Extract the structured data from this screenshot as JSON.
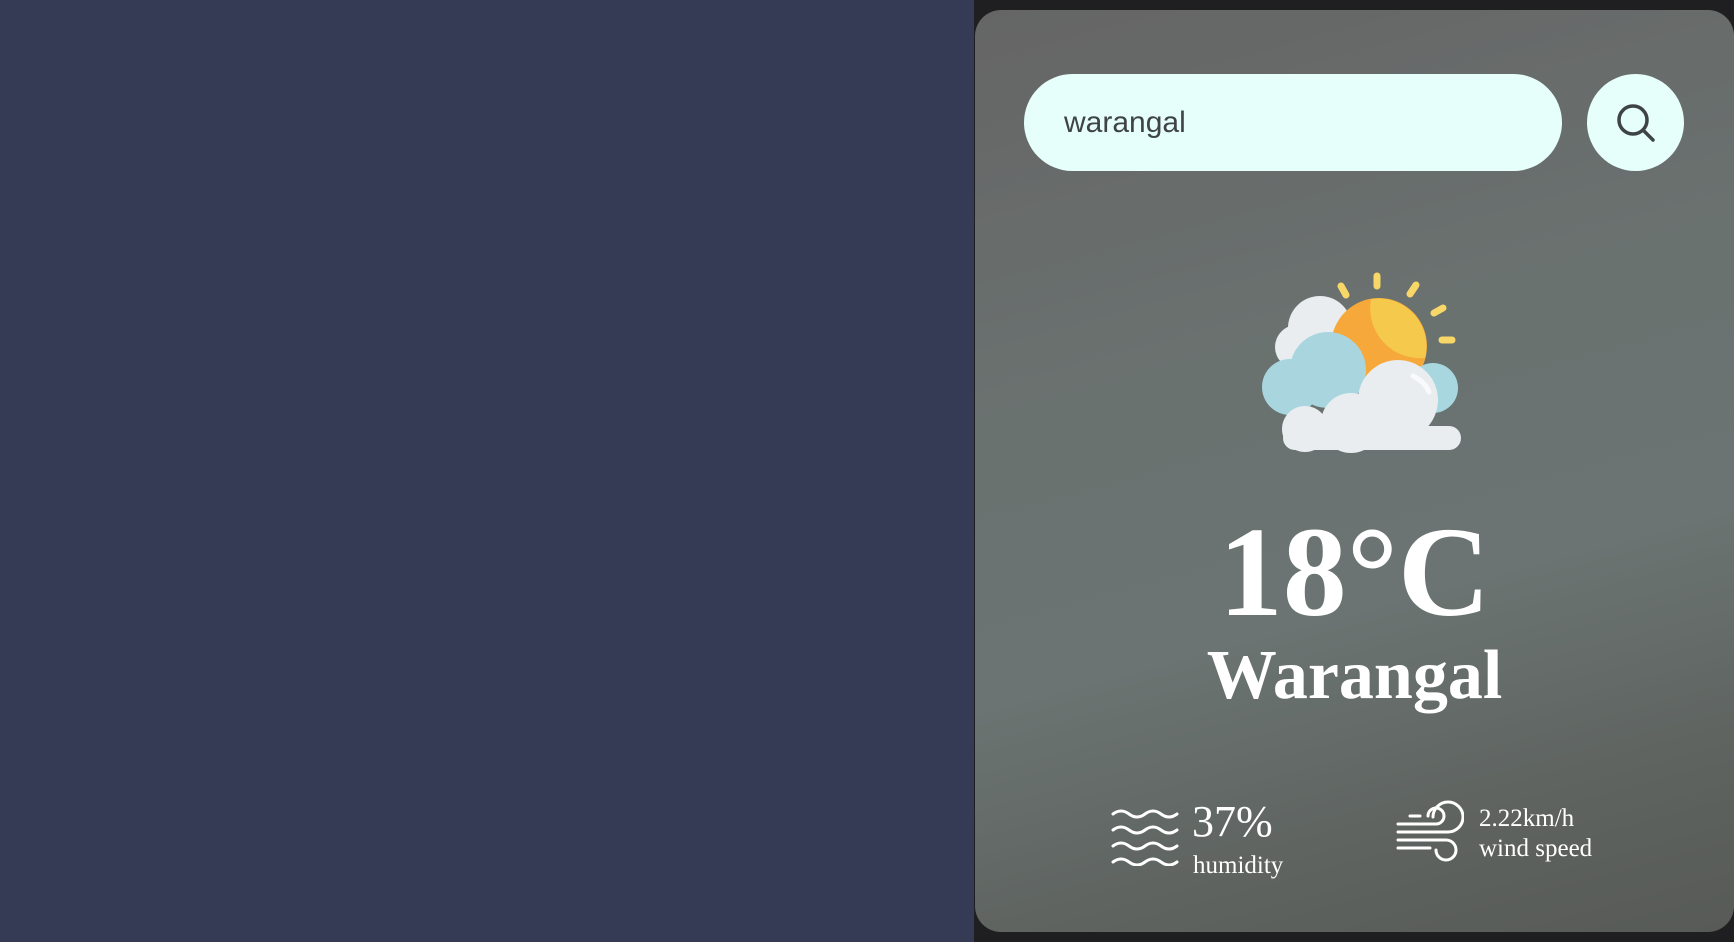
{
  "search": {
    "value": "warangal"
  },
  "weather": {
    "icon": "partly-cloudy-icon",
    "temperature": "18°C",
    "city": "Warangal"
  },
  "humidity": {
    "icon": "humidity-waves-icon",
    "value": "37%",
    "label": "humidity"
  },
  "wind": {
    "icon": "wind-icon",
    "value": "2.22km/h",
    "label": "wind speed"
  },
  "colors": {
    "left_background": "#353b54",
    "search_background": "#e6fffb",
    "text": "#ffffff"
  }
}
